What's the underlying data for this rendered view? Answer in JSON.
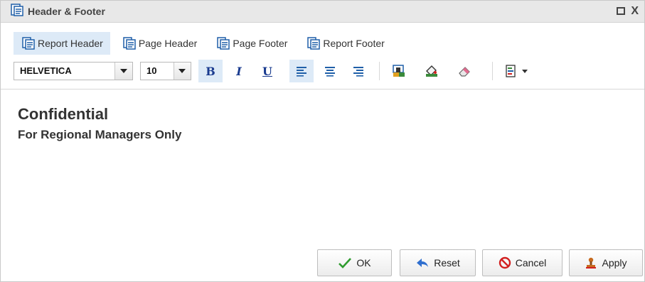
{
  "window": {
    "title": "Header & Footer",
    "maximize_icon": "maximize-icon",
    "close_label": "X"
  },
  "tabs": [
    {
      "label": "Report Header",
      "active": true
    },
    {
      "label": "Page Header",
      "active": false
    },
    {
      "label": "Page Footer",
      "active": false
    },
    {
      "label": "Report Footer",
      "active": false
    }
  ],
  "toolbar": {
    "font_family": "HELVETICA",
    "font_size": "10",
    "bold_label": "B",
    "italic_label": "I",
    "underline_label": "U",
    "align_active": "left"
  },
  "editor": {
    "line1": "Confidential",
    "line2": "For Regional Managers Only"
  },
  "buttons": {
    "ok": "OK",
    "reset": "Reset",
    "cancel": "Cancel",
    "apply": "Apply"
  },
  "colors": {
    "accent": "#ddeaf7",
    "ok_check": "#2e9b2e",
    "cancel_red": "#d22020"
  }
}
